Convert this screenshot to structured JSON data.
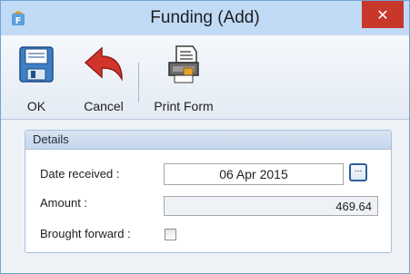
{
  "window": {
    "title": "Funding (Add)",
    "close_glyph": "✕",
    "app_icon": "app-f-icon"
  },
  "toolbar": {
    "ok_label": "OK",
    "cancel_label": "Cancel",
    "print_label": "Print Form"
  },
  "details": {
    "header": "Details",
    "date_label": "Date received :",
    "date_value": "06 Apr 2015",
    "date_button": "...",
    "amount_label": "Amount :",
    "amount_value": "469.64",
    "brought_forward_label": "Brought forward :",
    "brought_forward_checked": false
  },
  "colors": {
    "titlebar": "#c1daf5",
    "close": "#c7382b",
    "accent": "#2f5f99"
  }
}
